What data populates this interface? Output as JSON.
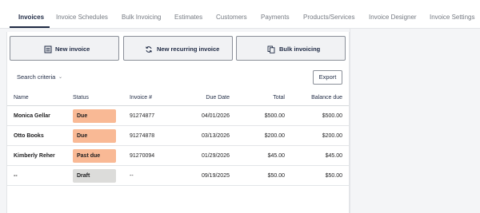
{
  "tabs": [
    "Invoices",
    "Invoice Schedules",
    "Bulk Invoicing",
    "Estimates",
    "Customers",
    "Payments",
    "Products/Services",
    "Invoice Designer",
    "Invoice Settings"
  ],
  "actions": {
    "new_invoice": "New invoice",
    "new_recurring_invoice": "New recurring invoice",
    "bulk_invoicing": "Bulk invoicing"
  },
  "filters": {
    "search_criteria": "Search criteria",
    "export": "Export"
  },
  "table": {
    "headers": {
      "name": "Name",
      "status": "Status",
      "invoice_number": "Invoice #",
      "due_date": "Due Date",
      "total": "Total",
      "balance_due": "Balance due"
    },
    "rows": [
      {
        "name": "Monica Gellar",
        "status": "Due",
        "status_color": "#f9b995",
        "invoice_number": "91274877",
        "due_date": "04/01/2026",
        "total": "$500.00",
        "balance_due": "$500.00"
      },
      {
        "name": "Otto Books",
        "status": "Due",
        "status_color": "#f9b995",
        "invoice_number": "91274878",
        "due_date": "03/13/2026",
        "total": "$200.00",
        "balance_due": "$200.00"
      },
      {
        "name": "Kimberly Reher",
        "status": "Past due",
        "status_color": "#f9b995",
        "invoice_number": "91270094",
        "due_date": "01/29/2026",
        "total": "$45.00",
        "balance_due": "$45.00"
      },
      {
        "name": "--",
        "status": "Draft",
        "status_color": "#dcdcda",
        "invoice_number": "--",
        "due_date": "09/19/2025",
        "total": "$50.00",
        "balance_due": "$50.00"
      }
    ]
  }
}
